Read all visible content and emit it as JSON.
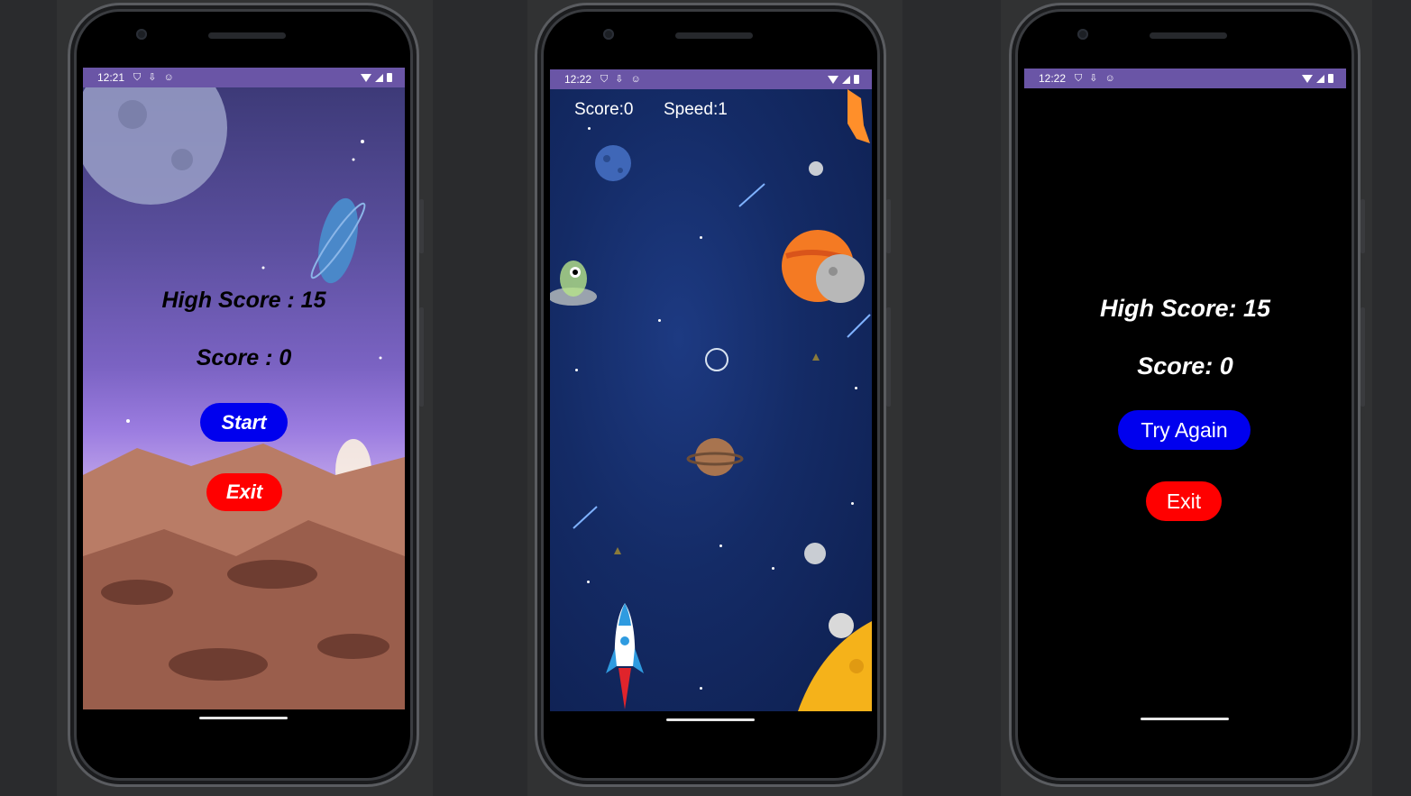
{
  "screens": {
    "menu": {
      "status_time": "12:21",
      "high_score": "High Score : 15",
      "score": "Score : 0",
      "start_label": "Start",
      "exit_label": "Exit"
    },
    "game": {
      "status_time": "12:22",
      "score": "Score:0",
      "speed": "Speed:1"
    },
    "gameover": {
      "status_time": "12:22",
      "high_score": "High Score: 15",
      "score": "Score: 0",
      "try_again_label": "Try Again",
      "exit_label": "Exit"
    }
  },
  "colors": {
    "status_bar": "#6a55a6",
    "start_button": "#0000ee",
    "exit_button": "#ff0000",
    "try_again_button": "#0000ee"
  },
  "icons": [
    "shield-icon",
    "download-icon",
    "face-icon",
    "wifi-icon",
    "cellular-icon",
    "battery-icon"
  ]
}
